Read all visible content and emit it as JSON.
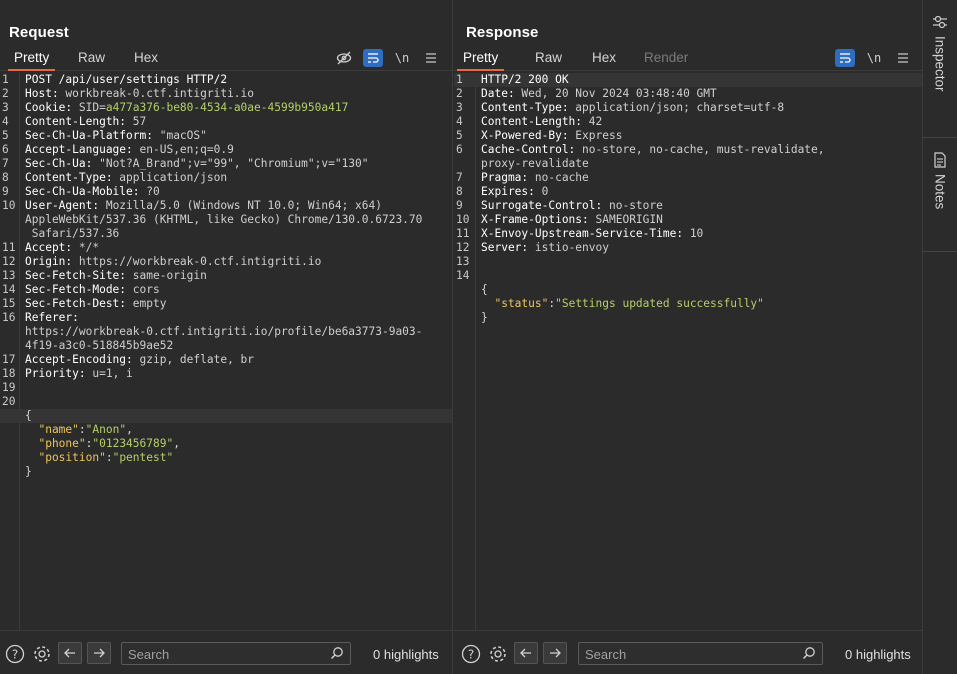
{
  "layout_buttons": [
    "split-vertical",
    "split-horizontal",
    "single"
  ],
  "request": {
    "title": "Request",
    "tabs": [
      "Pretty",
      "Raw",
      "Hex"
    ],
    "tools": {
      "newline": "\\n"
    },
    "lines": [
      {
        "n": "1",
        "name": "POST /api/user/settings HTTP/2",
        "value": ""
      },
      {
        "n": "2",
        "name": "Host:",
        "value": " workbreak-0.ctf.intigriti.io"
      },
      {
        "n": "3",
        "name": "Cookie:",
        "value": " SID=",
        "extra": "a477a376-be80-4534-a0ae-4599b950a417"
      },
      {
        "n": "4",
        "name": "Content-Length:",
        "value": " 57"
      },
      {
        "n": "5",
        "name": "Sec-Ch-Ua-Platform:",
        "value": " \"macOS\""
      },
      {
        "n": "6",
        "name": "Accept-Language:",
        "value": " en-US,en;q=0.9"
      },
      {
        "n": "7",
        "name": "Sec-Ch-Ua:",
        "value": " \"Not?A_Brand\";v=\"99\", \"Chromium\";v=\"130\""
      },
      {
        "n": "8",
        "name": "Content-Type:",
        "value": " application/json"
      },
      {
        "n": "9",
        "name": "Sec-Ch-Ua-Mobile:",
        "value": " ?0"
      },
      {
        "n": "10",
        "name": "User-Agent:",
        "value": " Mozilla/5.0 (Windows NT 10.0; Win64; x64)"
      },
      {
        "n": "",
        "name": "",
        "value": "AppleWebKit/537.36 (KHTML, like Gecko) Chrome/130.0.6723.70"
      },
      {
        "n": "",
        "name": "",
        "value": " Safari/537.36"
      },
      {
        "n": "11",
        "name": "Accept:",
        "value": " */*"
      },
      {
        "n": "12",
        "name": "Origin:",
        "value": " https://workbreak-0.ctf.intigriti.io"
      },
      {
        "n": "13",
        "name": "Sec-Fetch-Site:",
        "value": " same-origin"
      },
      {
        "n": "14",
        "name": "Sec-Fetch-Mode:",
        "value": " cors"
      },
      {
        "n": "15",
        "name": "Sec-Fetch-Dest:",
        "value": " empty"
      },
      {
        "n": "16",
        "name": "Referer:",
        "value": ""
      },
      {
        "n": "",
        "name": "",
        "value": "https://workbreak-0.ctf.intigriti.io/profile/be6a3773-9a03-"
      },
      {
        "n": "",
        "name": "",
        "value": "4f19-a3c0-518845b9ae52"
      },
      {
        "n": "17",
        "name": "Accept-Encoding:",
        "value": " gzip, deflate, br"
      },
      {
        "n": "18",
        "name": "Priority:",
        "value": " u=1, i"
      },
      {
        "n": "19",
        "name": "",
        "value": ""
      },
      {
        "n": "20",
        "name": "",
        "value": ""
      },
      {
        "n": "",
        "name": "",
        "value": "{"
      },
      {
        "n": "",
        "key": "  \"name\"",
        "value": ":",
        "str": "\"Anon\"",
        "tail": ","
      },
      {
        "n": "",
        "key": "  \"phone\"",
        "value": ":",
        "str": "\"0123456789\"",
        "tail": ","
      },
      {
        "n": "",
        "key": "  \"position\"",
        "value": ":",
        "str": "\"pentest\"",
        "tail": ""
      },
      {
        "n": "",
        "name": "",
        "value": "}"
      }
    ],
    "search_placeholder": "Search",
    "highlights": "0 highlights"
  },
  "response": {
    "title": "Response",
    "tabs": [
      "Pretty",
      "Raw",
      "Hex",
      "Render"
    ],
    "tools": {
      "newline": "\\n"
    },
    "lines": [
      {
        "n": "1",
        "name": "HTTP/2 200 OK",
        "value": ""
      },
      {
        "n": "2",
        "name": "Date:",
        "value": " Wed, 20 Nov 2024 03:48:40 GMT"
      },
      {
        "n": "3",
        "name": "Content-Type:",
        "value": " application/json; charset=utf-8"
      },
      {
        "n": "4",
        "name": "Content-Length:",
        "value": " 42"
      },
      {
        "n": "5",
        "name": "X-Powered-By:",
        "value": " Express"
      },
      {
        "n": "6",
        "name": "Cache-Control:",
        "value": " no-store, no-cache, must-revalidate,"
      },
      {
        "n": "",
        "name": "",
        "value": "proxy-revalidate"
      },
      {
        "n": "7",
        "name": "Pragma:",
        "value": " no-cache"
      },
      {
        "n": "8",
        "name": "Expires:",
        "value": " 0"
      },
      {
        "n": "9",
        "name": "Surrogate-Control:",
        "value": " no-store"
      },
      {
        "n": "10",
        "name": "X-Frame-Options:",
        "value": " SAMEORIGIN"
      },
      {
        "n": "11",
        "name": "X-Envoy-Upstream-Service-Time:",
        "value": " 10"
      },
      {
        "n": "12",
        "name": "Server:",
        "value": " istio-envoy"
      },
      {
        "n": "13",
        "name": "",
        "value": ""
      },
      {
        "n": "14",
        "name": "",
        "value": ""
      },
      {
        "n": "",
        "name": "",
        "value": "{"
      },
      {
        "n": "",
        "key": "  \"status\"",
        "value": ":",
        "str": "\"Settings updated successfully\"",
        "tail": ""
      },
      {
        "n": "",
        "name": "",
        "value": "}"
      }
    ],
    "search_placeholder": "Search",
    "highlights": "0 highlights"
  },
  "sidebar": {
    "inspector": "Inspector",
    "notes": "Notes"
  }
}
